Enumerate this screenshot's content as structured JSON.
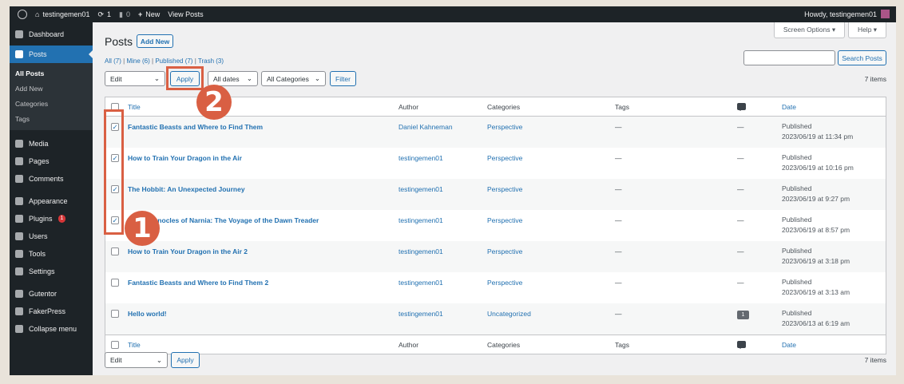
{
  "adminbar": {
    "site": "testingemen01",
    "updates": "1",
    "comments": "0",
    "new": "New",
    "view": "View Posts",
    "howdy": "Howdy, testingemen01"
  },
  "sidebar": {
    "dashboard": "Dashboard",
    "posts": "Posts",
    "sub": [
      "All Posts",
      "Add New",
      "Categories",
      "Tags"
    ],
    "items": [
      "Media",
      "Pages",
      "Comments",
      "Appearance",
      "Plugins",
      "Users",
      "Tools",
      "Settings",
      "Gutentor",
      "FakerPress",
      "Collapse menu"
    ],
    "plugins_badge": "1"
  },
  "header": {
    "title": "Posts",
    "add_new": "Add New",
    "screen_options": "Screen Options ▾",
    "help": "Help ▾"
  },
  "filters": {
    "all": "All (7)",
    "mine": "Mine (6)",
    "published": "Published (7)",
    "trash": "Trash (3)",
    "sep": "|"
  },
  "search": {
    "value": "",
    "button": "Search Posts"
  },
  "bulk": {
    "action": "Edit",
    "apply": "Apply",
    "dates": "All dates",
    "categories": "All Categories",
    "filter": "Filter",
    "count": "7 items"
  },
  "columns": {
    "title": "Title",
    "author": "Author",
    "categories": "Categories",
    "tags": "Tags",
    "date": "Date"
  },
  "rows": [
    {
      "checked": true,
      "title": "Fantastic Beasts and Where to Find Them",
      "author": "Daniel Kahneman",
      "category": "Perspective",
      "tags": "—",
      "comments": "—",
      "status": "Published",
      "date": "2023/06/19 at 11:34 pm"
    },
    {
      "checked": true,
      "title": "How to Train Your Dragon in the Air",
      "author": "testingemen01",
      "category": "Perspective",
      "tags": "—",
      "comments": "—",
      "status": "Published",
      "date": "2023/06/19 at 10:16 pm"
    },
    {
      "checked": true,
      "title": "The Hobbit: An Unexpected Journey",
      "author": "testingemen01",
      "category": "Perspective",
      "tags": "—",
      "comments": "—",
      "status": "Published",
      "date": "2023/06/19 at 9:27 pm"
    },
    {
      "checked": true,
      "title": "The Chronocles of Narnia: The Voyage of the Dawn Treader",
      "author": "testingemen01",
      "category": "Perspective",
      "tags": "—",
      "comments": "—",
      "status": "Published",
      "date": "2023/06/19 at 8:57 pm"
    },
    {
      "checked": false,
      "title": "How to Train Your Dragon in the Air 2",
      "author": "testingemen01",
      "category": "Perspective",
      "tags": "—",
      "comments": "—",
      "status": "Published",
      "date": "2023/06/19 at 3:18 pm"
    },
    {
      "checked": false,
      "title": "Fantastic Beasts and Where to Find Them 2",
      "author": "testingemen01",
      "category": "Perspective",
      "tags": "—",
      "comments": "—",
      "status": "Published",
      "date": "2023/06/19 at 3:13 am"
    },
    {
      "checked": false,
      "title": "Hello world!",
      "author": "testingemen01",
      "category": "Uncategorized",
      "tags": "—",
      "comments": "1",
      "status": "Published",
      "date": "2023/06/13 at 6:19 am"
    }
  ],
  "annotations": {
    "step1": "1",
    "step2": "2"
  }
}
